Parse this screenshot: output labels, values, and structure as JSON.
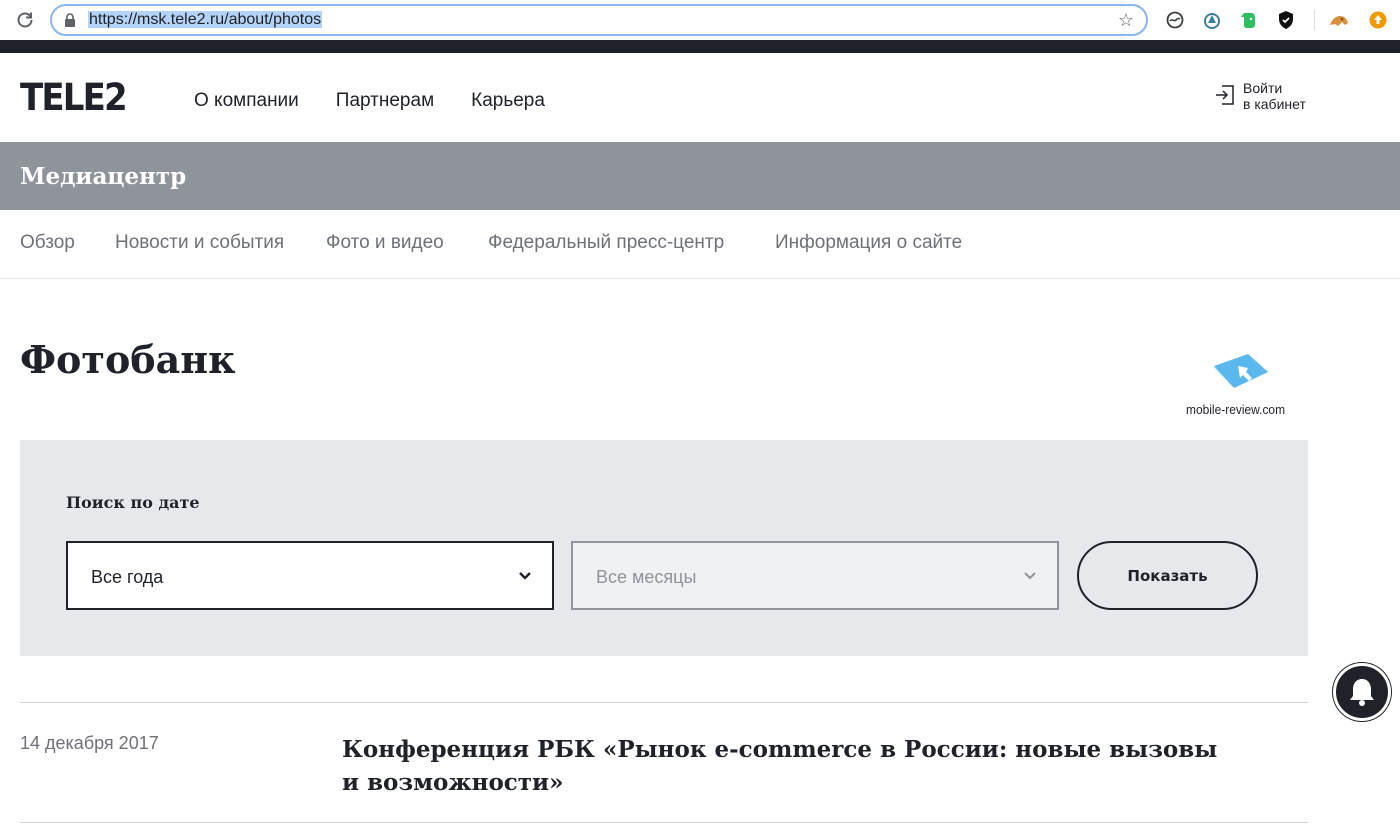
{
  "browser": {
    "url": "https://msk.tele2.ru/about/photos",
    "extensions": [
      "theme-icon",
      "astro-icon",
      "evernote-icon",
      "shield-icon",
      "puzzle-icon",
      "update-icon"
    ]
  },
  "header": {
    "logo": "TELE2",
    "nav": [
      "О компании",
      "Партнерам",
      "Карьера"
    ],
    "login_line1": "Войти",
    "login_line2": "в кабинет"
  },
  "band": {
    "title": "Медиацентр"
  },
  "subnav": [
    "Обзор",
    "Новости и события",
    "Фото и видео",
    "Федеральный пресс-центр",
    "Информация о сайте"
  ],
  "page": {
    "title": "Фотобанк"
  },
  "watermark": {
    "text": "mobile-review.com"
  },
  "search": {
    "label": "Поиск по дате",
    "year_select": "Все года",
    "month_select": "Все месяцы",
    "button": "Показать"
  },
  "items": [
    {
      "date": "14 декабря 2017",
      "title": "Конференция РБК «Рынок e-commerce в России: новые вызовы и возможности»"
    }
  ],
  "colors": {
    "dark": "#1f2229",
    "band": "#8f939a",
    "panel": "#e7e8ec",
    "muted": "#6e7178"
  }
}
